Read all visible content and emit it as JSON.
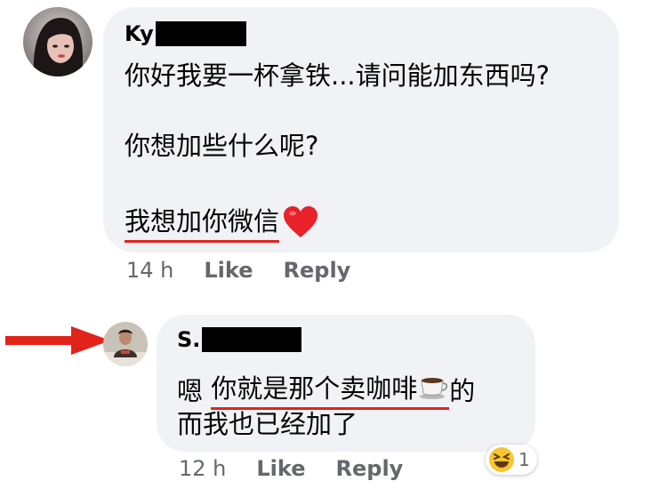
{
  "comment1": {
    "author_visible": "Ky",
    "lines": [
      "你好我要一杯拿铁...请问能加东西吗?",
      "你想加些什么呢?",
      "我想加你微信"
    ],
    "heart_emoji": "❤️",
    "time": "14 h",
    "like_label": "Like",
    "reply_label": "Reply"
  },
  "comment2": {
    "author_visible": "S.",
    "line1_prefix": "嗯 ",
    "line1_underlined": "你就是那个卖咖啡",
    "coffee_emoji": "☕",
    "line1_suffix": "的",
    "line2": "而我也已经加了",
    "time": "12 h",
    "like_label": "Like",
    "reply_label": "Reply",
    "reaction_emoji": "😆",
    "reaction_count": "1"
  },
  "colors": {
    "bubble": "#f0f2f5",
    "underline": "#e2231a",
    "arrow": "#e2231a",
    "meta_text": "#65676b"
  },
  "icons": [
    "red-arrow-icon",
    "heart-emoji-icon",
    "coffee-emoji-icon",
    "laughing-reaction-icon"
  ]
}
